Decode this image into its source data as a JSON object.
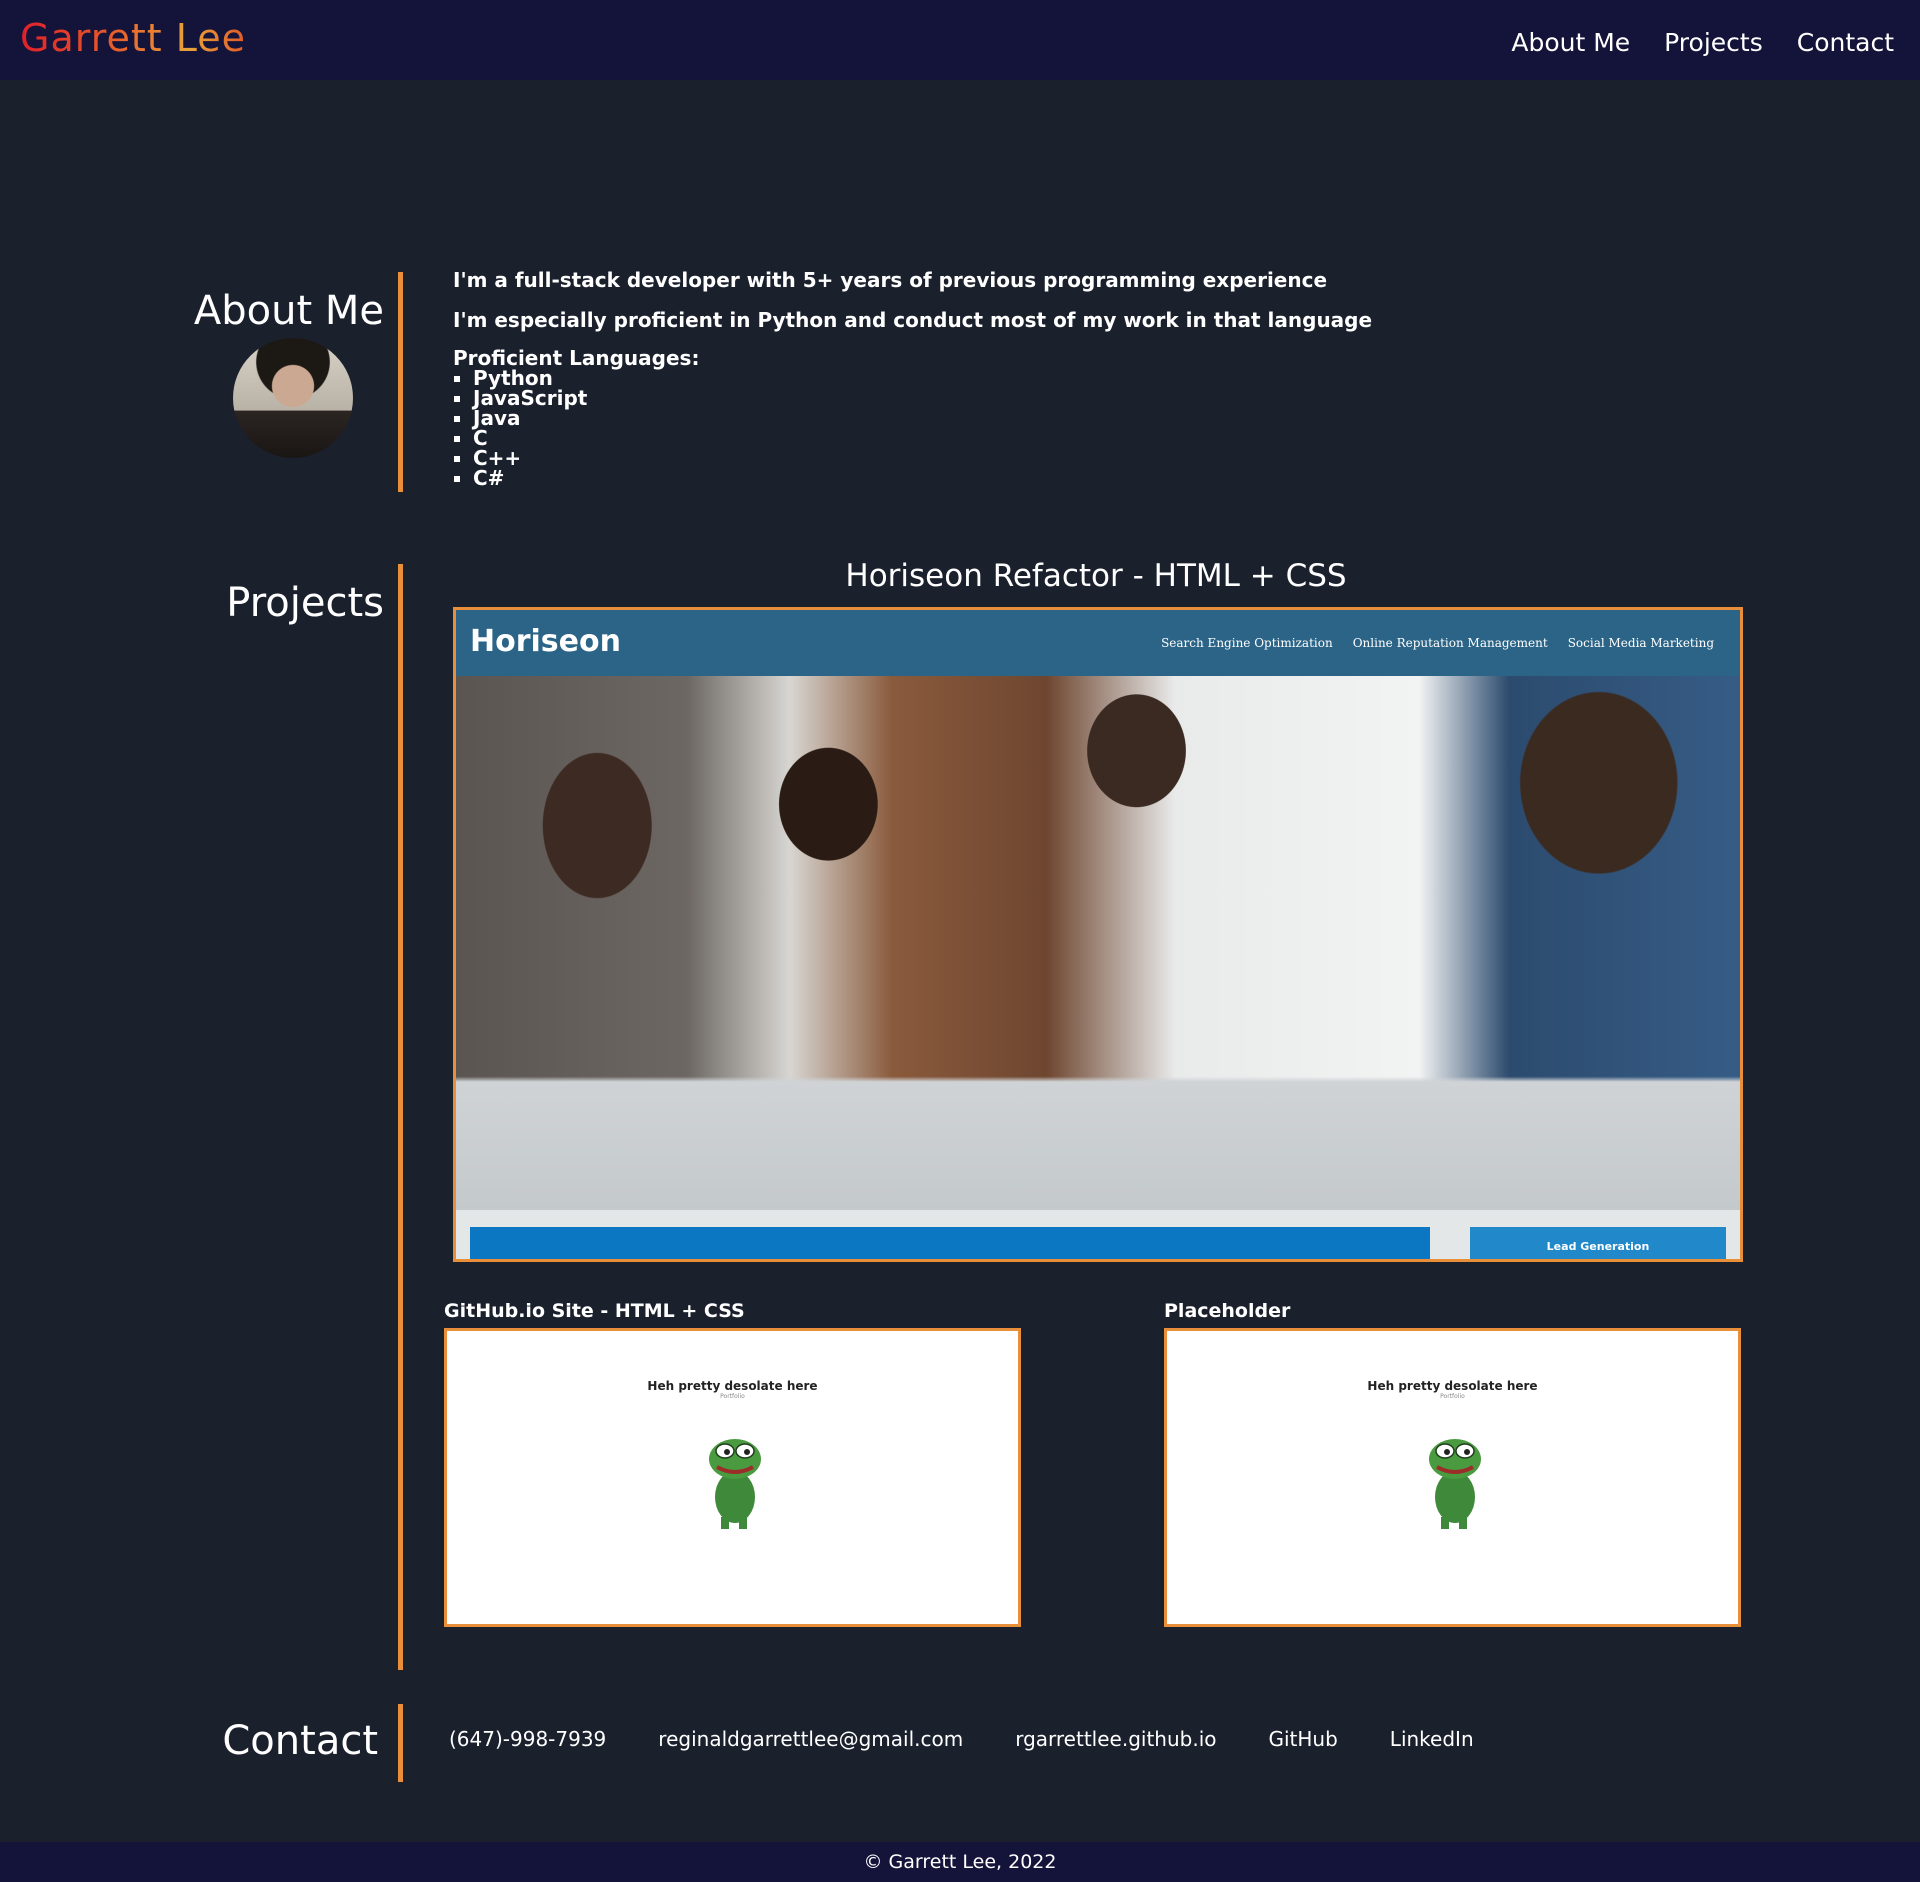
{
  "header": {
    "brand": "Garrett Lee",
    "nav": [
      "About Me",
      "Projects",
      "Contact"
    ]
  },
  "about": {
    "title": "About Me",
    "lines": [
      "I'm a full-stack developer with 5+ years of previous programming experience",
      "I'm especially proficient in Python and conduct most of my work in that language"
    ],
    "languages_title": "Proficient Languages:",
    "languages": [
      "Python",
      "JavaScript",
      "Java",
      "C",
      "C++",
      "C#"
    ]
  },
  "projects": {
    "title": "Projects",
    "main": {
      "title": "Horiseon Refactor - HTML + CSS",
      "shot": {
        "logo": "Horiseon",
        "nav": [
          "Search Engine Optimization",
          "Online Reputation Management",
          "Social Media Marketing"
        ],
        "footer_button": "Lead Generation"
      }
    },
    "cards": [
      {
        "title": "GitHub.io Site - HTML + CSS",
        "text": "Heh pretty desolate here",
        "subtext": "Portfolio"
      },
      {
        "title": "Placeholder",
        "text": "Heh pretty desolate here",
        "subtext": "Portfolio"
      }
    ]
  },
  "contact": {
    "title": "Contact",
    "links": [
      "(647)-998-7939",
      "reginaldgarrettlee@gmail.com",
      "rgarrettlee.github.io",
      "GitHub",
      "LinkedIn"
    ]
  },
  "footer": {
    "copyright": "© Garrett Lee, 2022"
  },
  "colors": {
    "background": "#1b202d",
    "header": "#14133a",
    "accent": "#e98f3a"
  },
  "icons": [
    "avatar-photo",
    "frog-image"
  ]
}
